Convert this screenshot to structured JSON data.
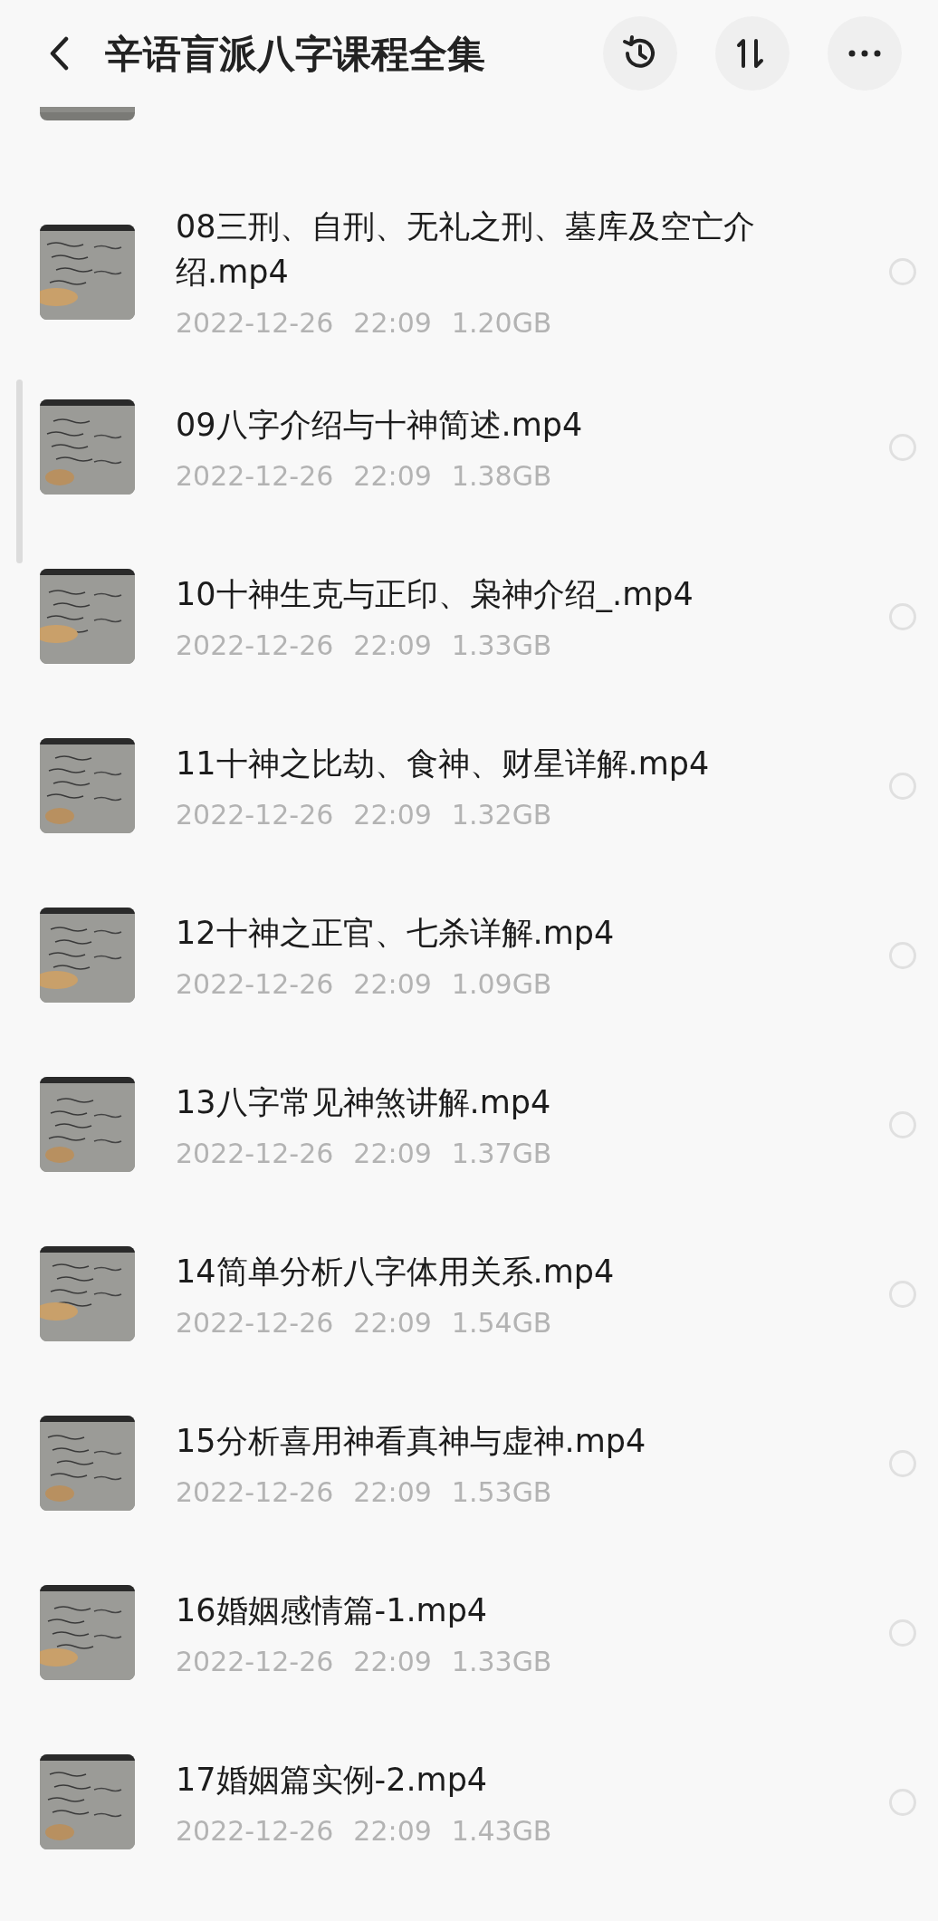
{
  "header": {
    "title": "辛语盲派八字课程全集"
  },
  "files": [
    {
      "name": "08三刑、自刑、无礼之刑、墓库及空亡介绍.mp4",
      "date": "2022-12-26",
      "time": "22:09",
      "size": "1.20GB",
      "selected": false
    },
    {
      "name": "09八字介绍与十神简述.mp4",
      "date": "2022-12-26",
      "time": "22:09",
      "size": "1.38GB",
      "selected": false
    },
    {
      "name": "10十神生克与正印、枭神介绍_.mp4",
      "date": "2022-12-26",
      "time": "22:09",
      "size": "1.33GB",
      "selected": false
    },
    {
      "name": "11十神之比劫、食神、财星详解.mp4",
      "date": "2022-12-26",
      "time": "22:09",
      "size": "1.32GB",
      "selected": false
    },
    {
      "name": "12十神之正官、七杀详解.mp4",
      "date": "2022-12-26",
      "time": "22:09",
      "size": "1.09GB",
      "selected": false
    },
    {
      "name": "13八字常见神煞讲解.mp4",
      "date": "2022-12-26",
      "time": "22:09",
      "size": "1.37GB",
      "selected": false
    },
    {
      "name": "14简单分析八字体用关系.mp4",
      "date": "2022-12-26",
      "time": "22:09",
      "size": "1.54GB",
      "selected": false
    },
    {
      "name": "15分析喜用神看真神与虚神.mp4",
      "date": "2022-12-26",
      "time": "22:09",
      "size": "1.53GB",
      "selected": false
    },
    {
      "name": "16婚姻感情篇-1.mp4",
      "date": "2022-12-26",
      "time": "22:09",
      "size": "1.33GB",
      "selected": false
    },
    {
      "name": "17婚姻篇实例-2.mp4",
      "date": "2022-12-26",
      "time": "22:09",
      "size": "1.43GB",
      "selected": false
    }
  ]
}
